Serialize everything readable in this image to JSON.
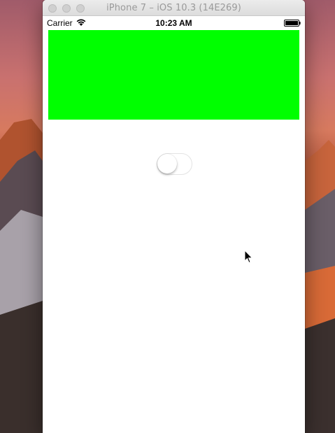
{
  "simulator": {
    "title": "iPhone 7 – iOS 10.3 (14E269)"
  },
  "status_bar": {
    "carrier": "Carrier",
    "time": "10:23 AM",
    "wifi_icon": "wifi-icon",
    "battery_icon": "battery-icon"
  },
  "app": {
    "top_view_color": "#00ff00",
    "switch_on": false
  },
  "colors": {
    "green": "#00ff00",
    "background": "#ffffff"
  }
}
